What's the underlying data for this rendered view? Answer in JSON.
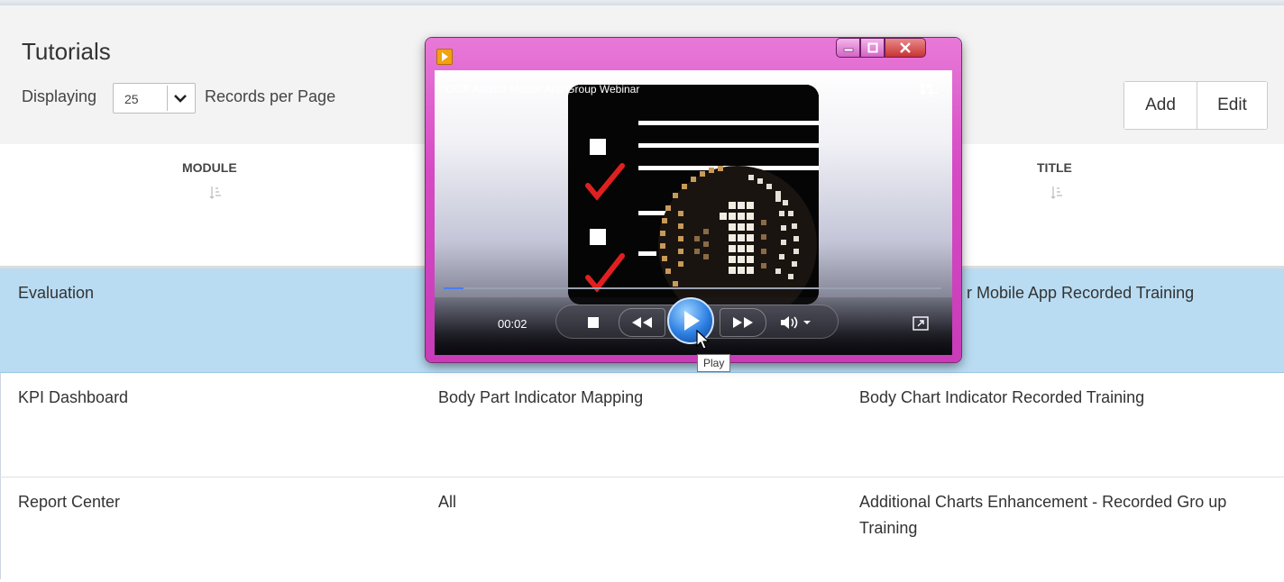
{
  "page": {
    "title": "Tutorials",
    "displaying_label": "Displaying",
    "records_per_page_value": "25",
    "records_per_page_label": "Records per Page",
    "buttons": {
      "add": "Add",
      "edit": "Edit"
    }
  },
  "table": {
    "headers": [
      "MODULE",
      "TITLE"
    ],
    "rows": [
      {
        "module": "Evaluation",
        "submodule": "",
        "title": "r Mobile App Recorded Training",
        "selected": true
      },
      {
        "module": "KPI Dashboard",
        "submodule": "Body Part Indicator Mapping",
        "title": "Body Chart Indicator Recorded Training",
        "selected": false
      },
      {
        "module": "Report Center",
        "submodule": "All",
        "title": "Additional Charts Enhancement - Recorded Gro up Training",
        "selected": false
      }
    ]
  },
  "player": {
    "video_title": "OGP Auditor Mobile App Group Webinar",
    "time": "00:02",
    "progress": 0.04,
    "tooltip": "Play",
    "icons": [
      "media-player-icon",
      "minimize-icon",
      "maximize-icon",
      "close-icon",
      "switch-to-library-icon",
      "stop-icon",
      "rewind-icon",
      "play-icon",
      "fast-forward-icon",
      "volume-icon",
      "fullscreen-icon",
      "cursor-icon"
    ]
  },
  "colors": {
    "selected_row": "#b9dcf2",
    "player_frame": "#d64bc4",
    "checkmark": "#e02020"
  }
}
